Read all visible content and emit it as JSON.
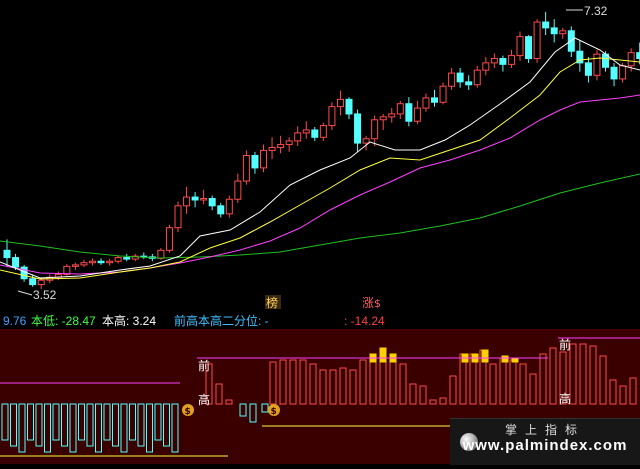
{
  "main_chart": {
    "price_high_label": "7.32",
    "price_low_label": "3.52",
    "marker_bang": "榜",
    "marker_zhang": "涨",
    "marker_dollar": "$"
  },
  "info_bar": {
    "v1": "9.76",
    "benlow": "本低: -28.47",
    "bengao": "本高: 3.24",
    "qian_label": "前高本高二分位: -",
    "qian_value": ": -14.24"
  },
  "indicator": {
    "qian_label": "前",
    "gao_label": "高",
    "money_icon": "$"
  },
  "watermark": {
    "cn": "掌上指标",
    "url": "www.palmindex.com"
  },
  "colors": {
    "up": "#ff4a4a",
    "down": "#54ffff",
    "ma_white": "#ffffff",
    "ma_yellow": "#ffff40",
    "ma_magenta": "#ff40ff",
    "ma_green": "#20c020",
    "panel_bg": "#3a0000",
    "panel_line": "#ff40ff"
  },
  "chart_data": {
    "type": "candlestick",
    "high_label": 7.32,
    "low_label": 3.52,
    "candles": [
      [
        4.05,
        4.2,
        3.82,
        3.95
      ],
      [
        3.95,
        4.0,
        3.78,
        3.82
      ],
      [
        3.82,
        3.85,
        3.62,
        3.66
      ],
      [
        3.66,
        3.72,
        3.55,
        3.58
      ],
      [
        3.58,
        3.68,
        3.52,
        3.64
      ],
      [
        3.64,
        3.72,
        3.6,
        3.68
      ],
      [
        3.68,
        3.76,
        3.64,
        3.72
      ],
      [
        3.72,
        3.86,
        3.7,
        3.83
      ],
      [
        3.83,
        3.88,
        3.78,
        3.85
      ],
      [
        3.85,
        3.92,
        3.82,
        3.88
      ],
      [
        3.88,
        3.94,
        3.84,
        3.9
      ],
      [
        3.9,
        3.94,
        3.85,
        3.88
      ],
      [
        3.88,
        3.93,
        3.84,
        3.9
      ],
      [
        3.9,
        3.98,
        3.87,
        3.95
      ],
      [
        3.95,
        4.0,
        3.9,
        3.93
      ],
      [
        3.93,
        4.0,
        3.9,
        3.97
      ],
      [
        3.97,
        4.02,
        3.93,
        3.96
      ],
      [
        3.96,
        4.0,
        3.9,
        3.94
      ],
      [
        3.94,
        4.08,
        3.92,
        4.05
      ],
      [
        4.05,
        4.4,
        4.02,
        4.36
      ],
      [
        4.36,
        4.72,
        4.3,
        4.66
      ],
      [
        4.66,
        4.92,
        4.55,
        4.78
      ],
      [
        4.78,
        4.85,
        4.64,
        4.74
      ],
      [
        4.74,
        4.88,
        4.68,
        4.76
      ],
      [
        4.76,
        4.8,
        4.6,
        4.66
      ],
      [
        4.66,
        4.7,
        4.5,
        4.55
      ],
      [
        4.55,
        4.8,
        4.5,
        4.75
      ],
      [
        4.75,
        5.1,
        4.7,
        5.0
      ],
      [
        5.0,
        5.42,
        4.95,
        5.35
      ],
      [
        5.35,
        5.4,
        5.1,
        5.18
      ],
      [
        5.18,
        5.5,
        5.12,
        5.42
      ],
      [
        5.42,
        5.6,
        5.3,
        5.46
      ],
      [
        5.46,
        5.62,
        5.38,
        5.5
      ],
      [
        5.5,
        5.6,
        5.4,
        5.55
      ],
      [
        5.55,
        5.75,
        5.48,
        5.66
      ],
      [
        5.66,
        5.82,
        5.58,
        5.7
      ],
      [
        5.7,
        5.74,
        5.55,
        5.6
      ],
      [
        5.6,
        5.8,
        5.55,
        5.76
      ],
      [
        5.76,
        6.08,
        5.7,
        6.02
      ],
      [
        6.02,
        6.24,
        5.9,
        6.12
      ],
      [
        6.12,
        6.15,
        5.85,
        5.92
      ],
      [
        5.92,
        5.98,
        5.4,
        5.52
      ],
      [
        5.52,
        5.62,
        5.42,
        5.58
      ],
      [
        5.58,
        5.9,
        5.48,
        5.84
      ],
      [
        5.84,
        5.92,
        5.7,
        5.88
      ],
      [
        5.88,
        6.0,
        5.8,
        5.92
      ],
      [
        5.92,
        6.1,
        5.85,
        6.06
      ],
      [
        6.06,
        6.15,
        5.75,
        5.82
      ],
      [
        5.82,
        6.1,
        5.78,
        6.0
      ],
      [
        6.0,
        6.2,
        5.95,
        6.14
      ],
      [
        6.14,
        6.25,
        6.02,
        6.08
      ],
      [
        6.08,
        6.35,
        6.05,
        6.3
      ],
      [
        6.3,
        6.55,
        6.25,
        6.48
      ],
      [
        6.48,
        6.55,
        6.28,
        6.36
      ],
      [
        6.36,
        6.45,
        6.25,
        6.32
      ],
      [
        6.32,
        6.58,
        6.28,
        6.52
      ],
      [
        6.52,
        6.7,
        6.45,
        6.62
      ],
      [
        6.62,
        6.75,
        6.55,
        6.68
      ],
      [
        6.68,
        6.72,
        6.5,
        6.6
      ],
      [
        6.6,
        6.8,
        6.55,
        6.72
      ],
      [
        6.72,
        7.05,
        6.65,
        6.98
      ],
      [
        6.98,
        7.0,
        6.62,
        6.68
      ],
      [
        6.68,
        7.22,
        6.62,
        7.18
      ],
      [
        7.18,
        7.32,
        7.0,
        7.1
      ],
      [
        7.1,
        7.22,
        6.9,
        7.02
      ],
      [
        7.02,
        7.1,
        6.95,
        7.06
      ],
      [
        7.06,
        7.12,
        6.7,
        6.78
      ],
      [
        6.78,
        6.92,
        6.5,
        6.62
      ],
      [
        6.62,
        6.7,
        6.35,
        6.45
      ],
      [
        6.45,
        6.8,
        6.38,
        6.74
      ],
      [
        6.74,
        6.78,
        6.5,
        6.56
      ],
      [
        6.56,
        6.62,
        6.3,
        6.4
      ],
      [
        6.4,
        6.62,
        6.35,
        6.58
      ],
      [
        6.58,
        6.82,
        6.5,
        6.76
      ],
      [
        6.76,
        6.9,
        6.6,
        6.68
      ]
    ],
    "indicator_values": [
      -9,
      -9,
      -9,
      -9,
      -9,
      -9,
      -9,
      -9,
      -9,
      -9,
      -9,
      -9,
      -9,
      -9,
      -9,
      -9,
      -9,
      -9,
      -9,
      -9,
      -9,
      -9,
      -9,
      -9,
      -9,
      -9,
      -9,
      -9,
      -9,
      -9,
      -9,
      -9,
      -9,
      -9,
      -9,
      -9,
      -9,
      -9,
      -9,
      -9,
      -9,
      -9,
      -9,
      -9,
      -9,
      -9,
      -9,
      -9,
      -9,
      -9,
      -9,
      -9
    ]
  }
}
